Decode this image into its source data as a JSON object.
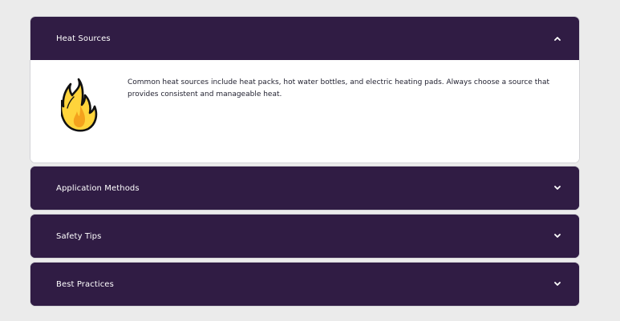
{
  "accordion": {
    "items": [
      {
        "title": "Heat Sources",
        "expanded": true,
        "chevron_icon": "chevron-up-icon",
        "content_icon": "fire-icon",
        "content": "Common heat sources include heat packs, hot water bottles, and electric heating pads. Always choose a source that provides consistent and manageable heat."
      },
      {
        "title": "Application Methods",
        "expanded": false,
        "chevron_icon": "chevron-down-icon"
      },
      {
        "title": "Safety Tips",
        "expanded": false,
        "chevron_icon": "chevron-down-icon"
      },
      {
        "title": "Best Practices",
        "expanded": false,
        "chevron_icon": "chevron-down-icon"
      }
    ]
  },
  "colors": {
    "header_bg": "#301c44",
    "page_bg": "#ebebeb",
    "flame_yellow": "#ffd43b",
    "flame_orange": "#f4a21d"
  }
}
